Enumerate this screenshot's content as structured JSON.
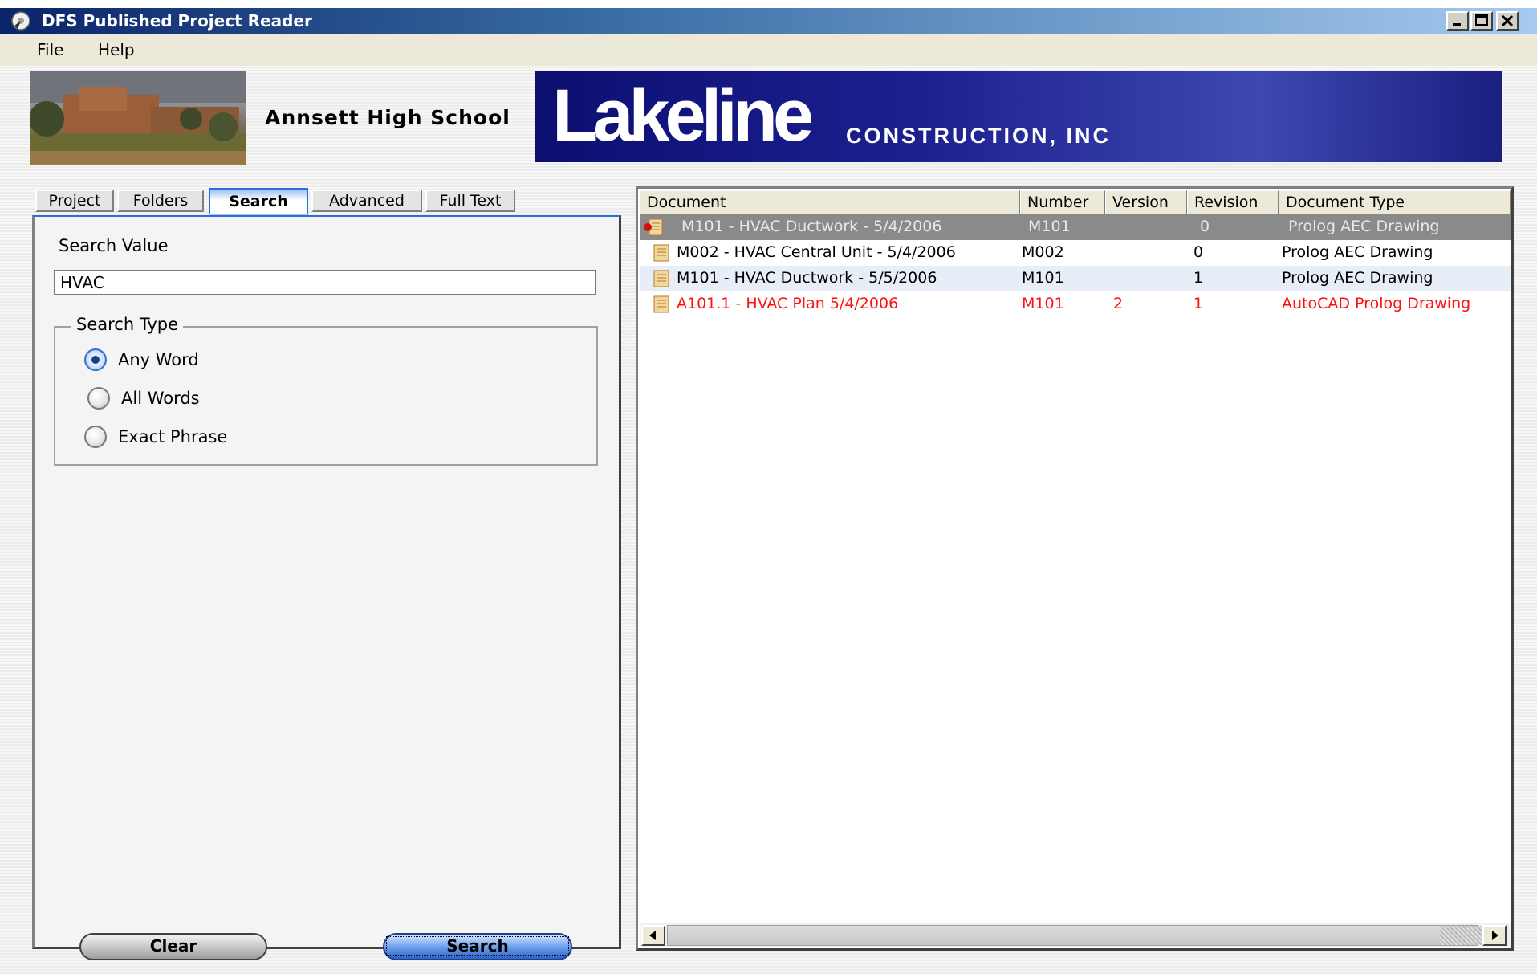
{
  "window": {
    "title": "DFS Published Project Reader",
    "icon": "app-disc-icon"
  },
  "menu": {
    "file": "File",
    "help": "Help"
  },
  "banner": {
    "project_name": "Annsett High School",
    "logo_main": "Lakeline",
    "logo_sub": "CONSTRUCTION, INC"
  },
  "tabs": [
    {
      "label": "Project"
    },
    {
      "label": "Folders"
    },
    {
      "label": "Search"
    },
    {
      "label": "Advanced"
    },
    {
      "label": "Full Text"
    }
  ],
  "search": {
    "value_label": "Search Value",
    "value": "HVAC",
    "type_label": "Search Type",
    "options": [
      {
        "label": "Any Word",
        "checked": true
      },
      {
        "label": "All Words",
        "checked": false
      },
      {
        "label": "Exact Phrase",
        "checked": false
      }
    ],
    "clear_label": "Clear",
    "search_label": "Search"
  },
  "results": {
    "columns": [
      "Document",
      "Number",
      "Version",
      "Revision",
      "Document Type"
    ],
    "rows": [
      {
        "document": "M101 - HVAC Ductwork - 5/4/2006",
        "number": "M101",
        "version": "",
        "revision": "0",
        "type": "Prolog AEC Drawing",
        "state": "selected"
      },
      {
        "document": "M002 - HVAC Central Unit - 5/4/2006",
        "number": "M002",
        "version": "",
        "revision": "0",
        "type": "Prolog AEC Drawing",
        "state": "normal"
      },
      {
        "document": "M101 - HVAC Ductwork - 5/5/2006",
        "number": "M101",
        "version": "",
        "revision": "1",
        "type": "Prolog AEC Drawing",
        "state": "alt"
      },
      {
        "document": "A101.1 - HVAC Plan 5/4/2006",
        "number": "M101",
        "version": "2",
        "revision": "1",
        "type": "AutoCAD Prolog Drawing",
        "state": "red"
      }
    ]
  },
  "colors": {
    "title_bar": "#0a246a",
    "logo_bg": "#1c2090",
    "selected_row": "#8a8a8a",
    "alert_row_text": "#ff1010",
    "active_tab": "#2a6fd6"
  }
}
